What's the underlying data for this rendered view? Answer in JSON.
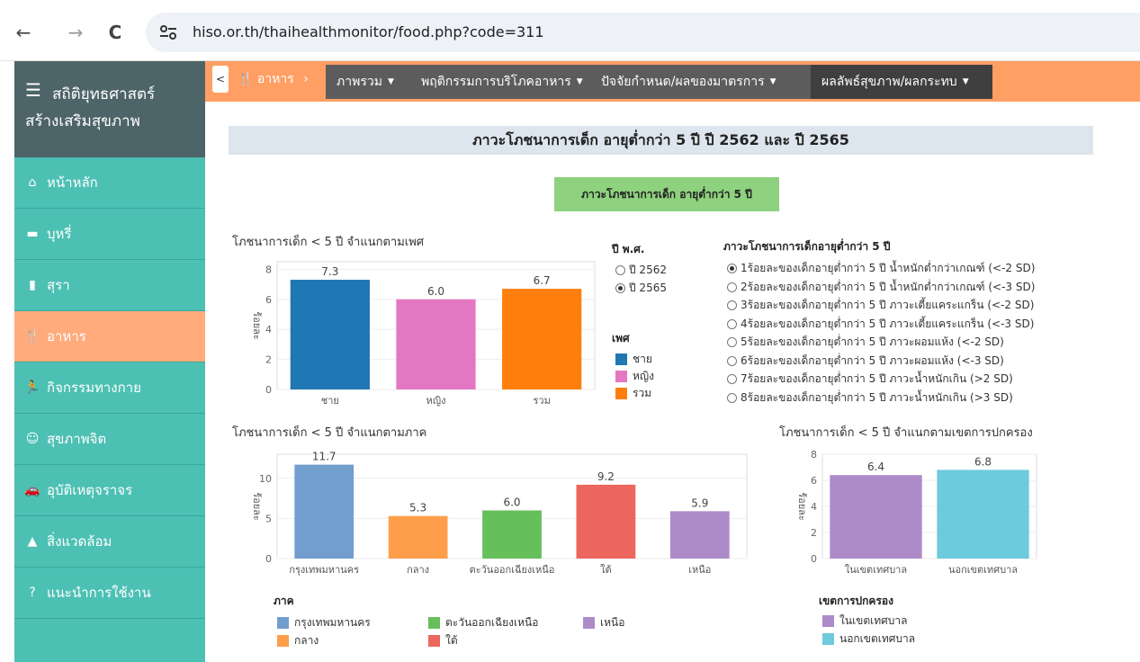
{
  "browser": {
    "back_icon": "←",
    "forward_icon": "→",
    "reload_icon": "C",
    "url": "hiso.or.th/thaihealthmonitor/food.php?code=311"
  },
  "sidebar": {
    "title_line1": "สถิติยุทธศาสตร์",
    "title_line2": "สร้างเสริมสุขภาพ",
    "items": [
      {
        "label": "หน้าหลัก",
        "icon": "home-icon"
      },
      {
        "label": "บุหรี่",
        "icon": "cigarette-icon"
      },
      {
        "label": "สุรา",
        "icon": "beer-icon"
      },
      {
        "label": "อาหาร",
        "icon": "utensils-icon",
        "active": true
      },
      {
        "label": "กิจกรรมทางกาย",
        "icon": "running-icon"
      },
      {
        "label": "สุขภาพจิต",
        "icon": "smile-icon"
      },
      {
        "label": "อุบัติเหตุจราจร",
        "icon": "car-crash-icon"
      },
      {
        "label": "สิ่งแวดล้อม",
        "icon": "tree-icon"
      },
      {
        "label": "แนะนำการใช้งาน",
        "icon": "question-icon"
      }
    ]
  },
  "topnav": {
    "back": "<",
    "crumb": "อาหาร",
    "menus": [
      "ภาพรวม",
      "พฤติกรรมการบริโภคอาหาร",
      "ปัจจัยกำหนด/ผลของมาตรการ",
      "ผลลัพธ์สุขภาพ/ผลกระทบ"
    ],
    "colors": {
      "bar": "#ff9f64",
      "menu": "#5c5c5c",
      "selected": "#3f3f3f"
    }
  },
  "page": {
    "title": "ภาวะโภชนาการเด็ก อายุต่ำกว่า 5 ปี ปี 2562 และ ปี 2565",
    "tag": "ภาวะโภชนาการเด็ก อายุต่ำกว่า 5 ปี"
  },
  "year_filter": {
    "title": "ปี พ.ศ.",
    "options": [
      {
        "label": "ปี 2562",
        "checked": false
      },
      {
        "label": "ปี 2565",
        "checked": true
      }
    ]
  },
  "indicator_filter": {
    "title": "ภาวะโภชนาการเด็กอายุต่ำกว่า 5 ปี",
    "options": [
      {
        "label": "1ร้อยละของเด็กอายุต่ำกว่า 5 ปี น้ำหนักต่ำกว่าเกณฑ์ (<-2 SD)",
        "checked": true
      },
      {
        "label": "2ร้อยละของเด็กอายุต่ำกว่า 5 ปี น้ำหนักต่ำกว่าเกณฑ์ (<-3 SD)",
        "checked": false
      },
      {
        "label": "3ร้อยละของเด็กอายุต่ำกว่า 5 ปี ภาวะเตี้ยแคระแกร็น (<-2 SD)",
        "checked": false
      },
      {
        "label": "4ร้อยละของเด็กอายุต่ำกว่า 5 ปี ภาวะเตี้ยแคระแกร็น (<-3 SD)",
        "checked": false
      },
      {
        "label": "5ร้อยละของเด็กอายุต่ำกว่า 5 ปี ภาวะผอมแห้ง (<-2 SD)",
        "checked": false
      },
      {
        "label": "6ร้อยละของเด็กอายุต่ำกว่า 5 ปี ภาวะผอมแห้ง (<-3 SD)",
        "checked": false
      },
      {
        "label": "7ร้อยละของเด็กอายุต่ำกว่า 5 ปี ภาวะน้ำหนักเกิน (>2 SD)",
        "checked": false
      },
      {
        "label": "8ร้อยละของเด็กอายุต่ำกว่า 5 ปี ภาวะน้ำหนักเกิน (>3 SD)",
        "checked": false
      }
    ]
  },
  "chart_data": [
    {
      "type": "bar",
      "title": "โภชนาการเด็ก < 5 ปี จำแนกตามเพศ",
      "ylabel": "ร้อยละ",
      "categories": [
        "ชาย",
        "หญิง",
        "รวม"
      ],
      "values": [
        7.3,
        6.0,
        6.7
      ],
      "labels": [
        "7.3",
        "6.0",
        "6.7"
      ],
      "colors": [
        "#1f77b4",
        "#e377c2",
        "#ff7f0e"
      ],
      "ylim": [
        0,
        8.5
      ],
      "yticks": [
        0,
        2,
        4,
        6,
        8
      ],
      "legend_title": "เพศ",
      "legend": [
        "ชาย",
        "หญิง",
        "รวม"
      ]
    },
    {
      "type": "bar",
      "title": "โภชนาการเด็ก < 5 ปี จำแนกตามภาค",
      "ylabel": "ร้อยละ",
      "categories": [
        "กรุงเทพมหานคร",
        "กลาง",
        "ตะวันออกเฉียงเหนือ",
        "ใต้",
        "เหนือ"
      ],
      "values": [
        11.7,
        5.3,
        6.0,
        9.2,
        5.9
      ],
      "labels": [
        "11.7",
        "5.3",
        "6.0",
        "9.2",
        "5.9"
      ],
      "colors": [
        "#729ece",
        "#ff9e4a",
        "#67bf5c",
        "#ed665d",
        "#ad8bc9"
      ],
      "ylim": [
        0,
        13
      ],
      "yticks": [
        0,
        5,
        10
      ],
      "legend_title": "ภาค",
      "legend": [
        "กรุงเทพมหานคร",
        "ตะวันออกเฉียงเหนือ",
        "เหนือ",
        "กลาง",
        "ใต้"
      ],
      "legend_colors": [
        "#729ece",
        "#67bf5c",
        "#ad8bc9",
        "#ff9e4a",
        "#ed665d"
      ]
    },
    {
      "type": "bar",
      "title": "โภชนาการเด็ก < 5 ปี จำแนกตามเขตการปกครอง",
      "ylabel": "ร้อยละ",
      "categories": [
        "ในเขตเทศบาล",
        "นอกเขตเทศบาล"
      ],
      "values": [
        6.4,
        6.8
      ],
      "labels": [
        "6.4",
        "6.8"
      ],
      "colors": [
        "#ad8bc9",
        "#6ccbdc"
      ],
      "ylim": [
        0,
        8
      ],
      "yticks": [
        0,
        2,
        4,
        6,
        8
      ],
      "legend_title": "เขตการปกครอง",
      "legend": [
        "ในเขตเทศบาล",
        "นอกเขตเทศบาล"
      ]
    }
  ]
}
